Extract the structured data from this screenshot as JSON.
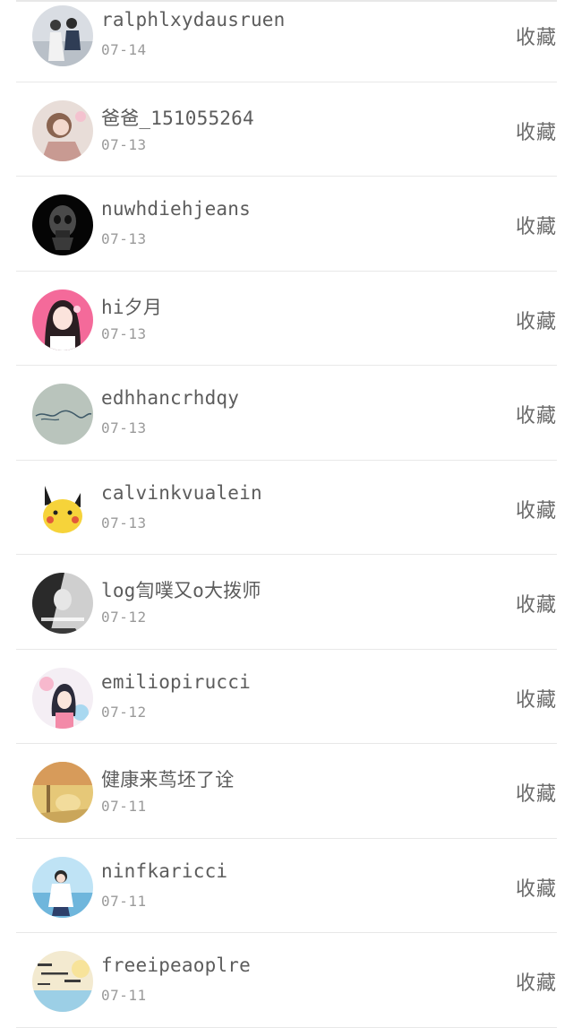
{
  "favorite_label": "收藏",
  "users": [
    {
      "name": "ralphlxydausruen",
      "date": "07-14",
      "avatar": "person-photo-avatar"
    },
    {
      "name": "爸爸_151055264",
      "date": "07-13",
      "avatar": "girl-photo-avatar"
    },
    {
      "name": "nuwhdiehjeans",
      "date": "07-13",
      "avatar": "dark-skull-avatar"
    },
    {
      "name": "hi夕月",
      "date": "07-13",
      "avatar": "anime-girl-avatar"
    },
    {
      "name": "edhhancrhdqy",
      "date": "07-13",
      "avatar": "handwriting-avatar"
    },
    {
      "name": "calvinkvualein",
      "date": "07-13",
      "avatar": "pikachu-avatar"
    },
    {
      "name": "log訇噗又o大拨师",
      "date": "07-12",
      "avatar": "bw-portrait-avatar"
    },
    {
      "name": "emiliopirucci",
      "date": "07-12",
      "avatar": "cartoon-girl-avatar"
    },
    {
      "name": "健康来茑坯了诠",
      "date": "07-11",
      "avatar": "warm-scene-avatar"
    },
    {
      "name": "ninfkaricci",
      "date": "07-11",
      "avatar": "boy-seaside-avatar"
    },
    {
      "name": "freeipeaoplre",
      "date": "07-11",
      "avatar": "text-art-avatar"
    }
  ]
}
